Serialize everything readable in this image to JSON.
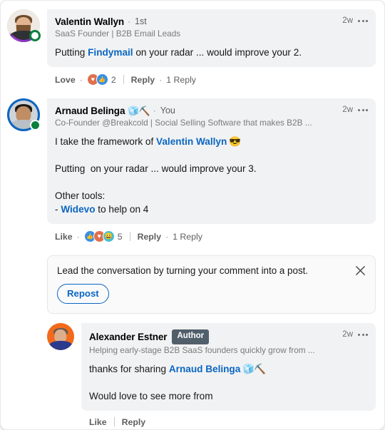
{
  "colors": {
    "link": "#0a66c2",
    "loved": "#dd4d2a",
    "bubble_bg": "#f1f2f3",
    "author_badge_bg": "#515f6b",
    "presence_green": "#0a7f3f",
    "frame_purple": "#9933cc"
  },
  "comments": [
    {
      "name": "Valentin Wallyn",
      "name_emoji": "",
      "separator": "·",
      "degree": "1st",
      "headline": "SaaS Founder | B2B Email Leads",
      "time": "2w",
      "text_lines": [
        [
          {
            "t": "Putting ",
            "k": "plain"
          },
          {
            "t": "Findymail",
            "k": "mention"
          },
          {
            "t": " on your radar ... would improve your 2.",
            "k": "plain"
          }
        ]
      ],
      "actions": {
        "like_label": "Love",
        "like_state": "loved",
        "reactions": [
          "love",
          "like"
        ],
        "reaction_count": "2",
        "reply_label": "Reply",
        "replies_label": "1 Reply"
      }
    },
    {
      "name": "Arnaud Belinga",
      "name_emoji": "🧊⛏️",
      "separator": "·",
      "degree": "You",
      "headline": "Co-Founder @Breakcold | Social Selling Software that makes B2B ...",
      "time": "2w",
      "text_lines": [
        [
          {
            "t": "I take the framework of ",
            "k": "plain"
          },
          {
            "t": "Valentin Wallyn",
            "k": "mention"
          },
          {
            "t": " 😎",
            "k": "emoji"
          }
        ],
        [],
        [
          {
            "t": "Putting  on your radar ... would improve your 3.",
            "k": "plain"
          }
        ],
        [],
        [
          {
            "t": "Other tools:",
            "k": "plain"
          }
        ],
        [
          {
            "t": "- ",
            "k": "plain"
          },
          {
            "t": "Widevo",
            "k": "mention"
          },
          {
            "t": " to help on 4",
            "k": "plain"
          }
        ]
      ],
      "actions": {
        "like_label": "Like",
        "like_state": "normal",
        "reactions": [
          "like",
          "love",
          "funny"
        ],
        "reaction_count": "5",
        "reply_label": "Reply",
        "replies_label": "1 Reply"
      }
    },
    {
      "name": "Alexander Estner",
      "name_emoji": "",
      "badge": "Author",
      "headline": "Helping early-stage B2B SaaS founders quickly grow from ...",
      "time": "2w",
      "text_lines": [
        [
          {
            "t": "thanks for sharing ",
            "k": "plain"
          },
          {
            "t": "Arnaud Belinga",
            "k": "mention"
          },
          {
            "t": " 🧊⛏️",
            "k": "emoji"
          }
        ],
        [],
        [
          {
            "t": "Would love to see more from",
            "k": "plain"
          }
        ]
      ],
      "actions": {
        "like_label": "Like",
        "like_state": "normal",
        "reactions": [],
        "reaction_count": "",
        "reply_label": "Reply",
        "replies_label": ""
      }
    }
  ],
  "promo": {
    "text": "Lead the conversation by turning your comment into a post.",
    "button_label": "Repost",
    "close_icon": "close-icon"
  }
}
